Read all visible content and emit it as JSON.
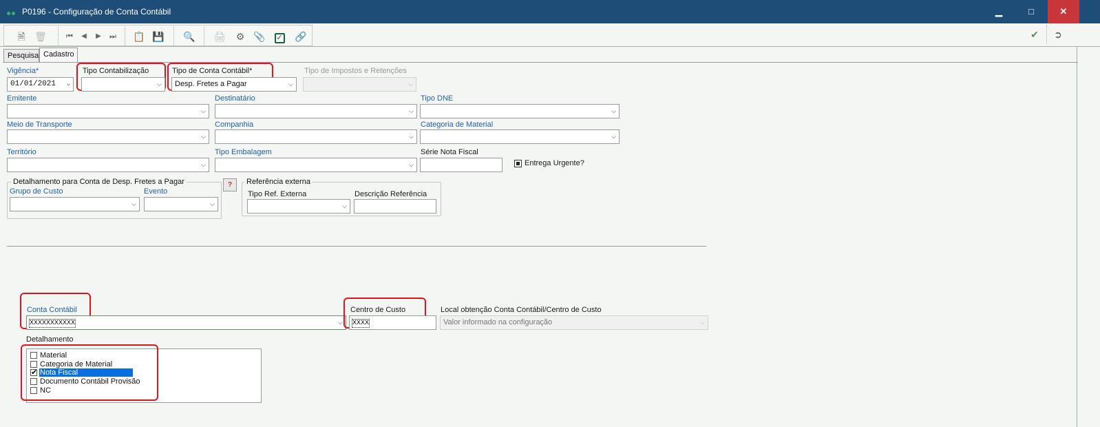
{
  "window": {
    "title": "P0196 - Configuração de Conta Contábil",
    "minimize": "▁",
    "maximize": "□",
    "close": "✕"
  },
  "tabs": [
    {
      "label": "Pesquisa"
    },
    {
      "label": "Cadastro"
    }
  ],
  "form": {
    "vigencia": {
      "label": "Vigência*",
      "value": "01/01/2021"
    },
    "tipo_contabilizacao": {
      "label": "Tipo Contabilização",
      "value": ""
    },
    "tipo_conta_contabil": {
      "label": "Tipo de Conta Contábil*",
      "value": "Desp. Fretes a Pagar"
    },
    "tipo_impostos": {
      "label": "Tipo de Impostos e Retenções",
      "value": ""
    },
    "emitente": {
      "label": "Emitente",
      "value": ""
    },
    "destinatario": {
      "label": "Destinatário",
      "value": ""
    },
    "tipo_dne": {
      "label": "Tipo DNE",
      "value": ""
    },
    "meio_transporte": {
      "label": "Meio de Transporte",
      "value": ""
    },
    "companhia": {
      "label": "Companhia",
      "value": ""
    },
    "categoria_material": {
      "label": "Categoria de Material",
      "value": ""
    },
    "territorio": {
      "label": "Território",
      "value": ""
    },
    "tipo_embalagem": {
      "label": "Tipo Embalagem",
      "value": ""
    },
    "serie_nota_fiscal": {
      "label": "Série Nota Fiscal",
      "value": ""
    },
    "entrega_urgente": {
      "label": "Entrega Urgente?"
    }
  },
  "detalhamento_group": {
    "title": "Detalhamento para Conta de Desp. Fretes a Pagar",
    "grupo_custo": {
      "label": "Grupo de Custo",
      "value": ""
    },
    "evento": {
      "label": "Evento",
      "value": ""
    },
    "help": "?"
  },
  "referencia_group": {
    "title": "Referência externa",
    "tipo_ref": {
      "label": "Tipo Ref. Externa",
      "value": ""
    },
    "descricao_ref": {
      "label": "Descrição Referência",
      "value": ""
    }
  },
  "conta": {
    "conta_contabil": {
      "label": "Conta Contábil",
      "value": "XXXXXXXXXXX"
    },
    "centro_custo": {
      "label": "Centro de Custo",
      "value": "XXXX"
    },
    "local_obtencao": {
      "label": "Local obtenção Conta Contábil/Centro de Custo",
      "value": "Valor informado na configuração"
    }
  },
  "detalhamento": {
    "label": "Detalhamento",
    "items": [
      {
        "label": "Material",
        "checked": false
      },
      {
        "label": "Categoria de Material",
        "checked": false
      },
      {
        "label": "Nota Fiscal",
        "checked": true
      },
      {
        "label": "Documento Contábil Provisão",
        "checked": false
      },
      {
        "label": "NC",
        "checked": false
      }
    ]
  },
  "colors": {
    "titlebar": "#1e4d78",
    "close": "#c8363a",
    "highlight": "#e0141e",
    "selection": "#0a6ee0",
    "label_blue": "#2060a8"
  }
}
